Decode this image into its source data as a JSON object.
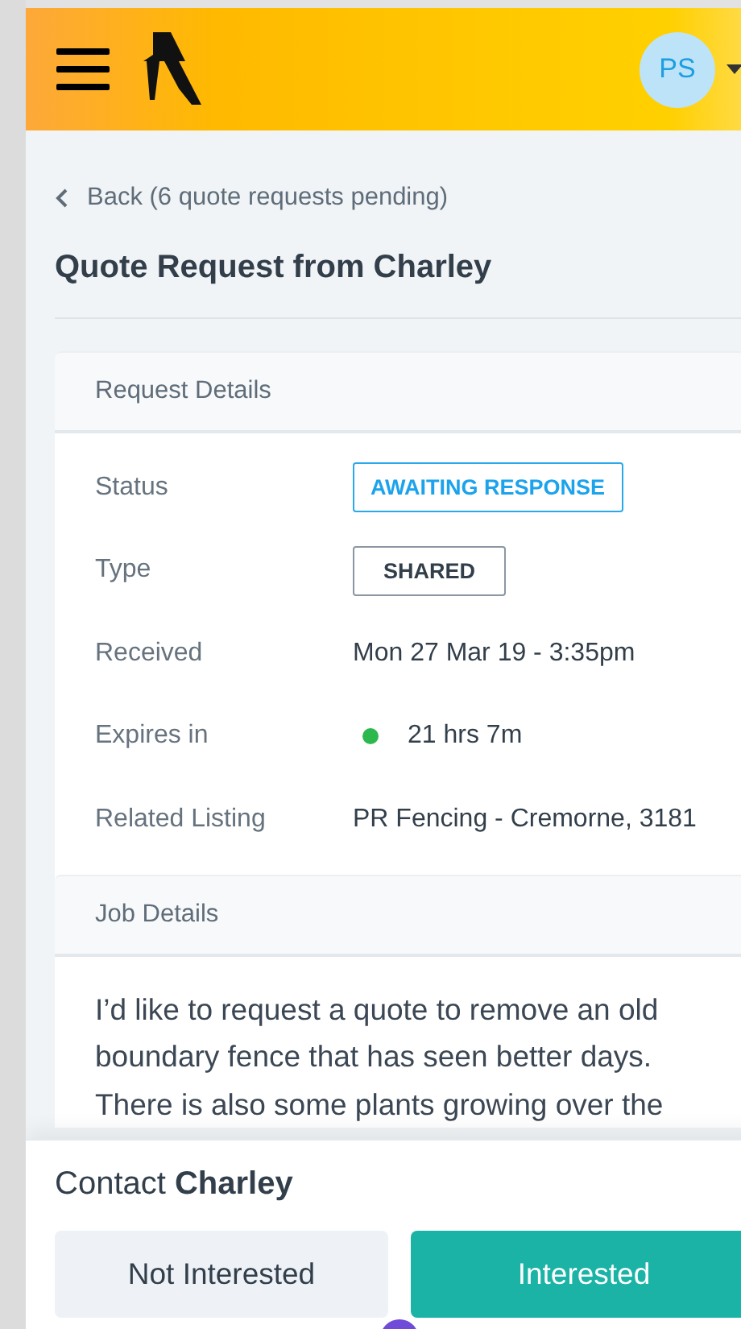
{
  "header": {
    "avatar": "PS"
  },
  "back_link": "Back (6 quote requests pending)",
  "title": "Quote Request from Charley",
  "request_details": {
    "heading": "Request Details",
    "rows": [
      {
        "label": "Status",
        "value": "AWAITING RESPONSE",
        "kind": "status"
      },
      {
        "label": "Type",
        "value": "SHARED",
        "kind": "tag"
      },
      {
        "label": "Received",
        "value": "Mon 27 Mar 19 - 3:35pm",
        "kind": "text"
      },
      {
        "label": "Expires in",
        "value": "21 hrs 7m",
        "kind": "timer"
      },
      {
        "label": "Related Listing",
        "value": "PR Fencing - Cremorne, 3181",
        "kind": "text"
      }
    ]
  },
  "job_details": {
    "heading": "Job Details",
    "text": "I’d like to request a quote to remove an old boundary fence that has seen better days. There is also some plants growing over the"
  },
  "contact": {
    "text": "Contact **Charley**",
    "buttons": [
      {
        "label": "Not Interested",
        "kind": "secondary"
      },
      {
        "label": "Interested",
        "kind": "primary"
      }
    ]
  }
}
